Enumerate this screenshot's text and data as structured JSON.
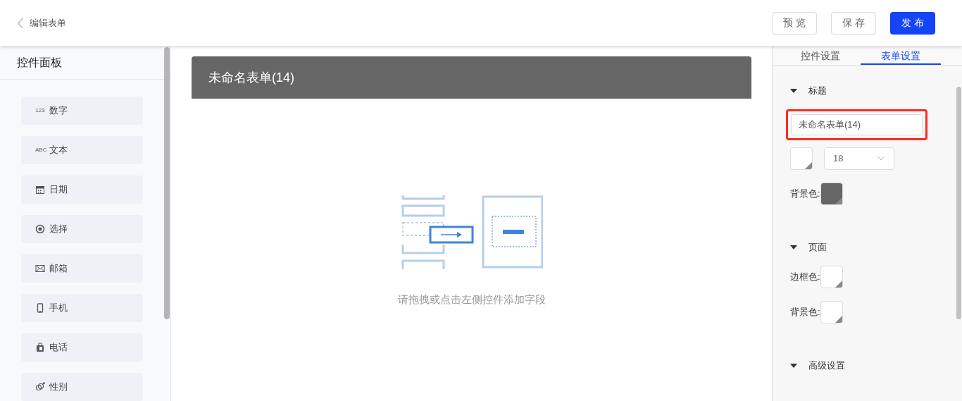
{
  "header": {
    "back_label": "编辑表单",
    "buttons": [
      {
        "label": "预 览",
        "kind": "default"
      },
      {
        "label": "保 存",
        "kind": "default"
      },
      {
        "label": "发 布",
        "kind": "primary"
      }
    ]
  },
  "palette": {
    "title": "控件面板",
    "items": [
      {
        "kind": "number",
        "icon_text": "123",
        "label": "数字"
      },
      {
        "kind": "text",
        "icon_text": "ABC",
        "label": "文本"
      },
      {
        "kind": "date",
        "label": "日期"
      },
      {
        "kind": "radio",
        "label": "选择"
      },
      {
        "kind": "mail",
        "label": "邮箱"
      },
      {
        "kind": "mobile",
        "label": "手机"
      },
      {
        "kind": "phone",
        "label": "电话"
      },
      {
        "kind": "gender",
        "label": "性别"
      }
    ]
  },
  "canvas": {
    "title": "未命名表单(14)",
    "empty_hint": "请拖拽或点击左侧控件添加字段"
  },
  "settings": {
    "tabs": [
      {
        "label": "控件设置",
        "selected": false
      },
      {
        "label": "表单设置",
        "selected": true
      }
    ],
    "sections": [
      {
        "title": "标题",
        "expanded": true,
        "title_field": {
          "value": "未命名表单(14)",
          "highlighted": true
        },
        "text_color": {
          "color": "#ffffff"
        },
        "font_size": "18",
        "rows": [
          {
            "label": "背景色:",
            "color": "#666666"
          }
        ]
      },
      {
        "title": "页面",
        "expanded": true,
        "rows": [
          {
            "label": "边框色:",
            "color": "#ffffff"
          },
          {
            "label": "背景色:",
            "color": "#ffffff"
          }
        ]
      },
      {
        "title": "高级设置",
        "expanded": true
      }
    ]
  }
}
